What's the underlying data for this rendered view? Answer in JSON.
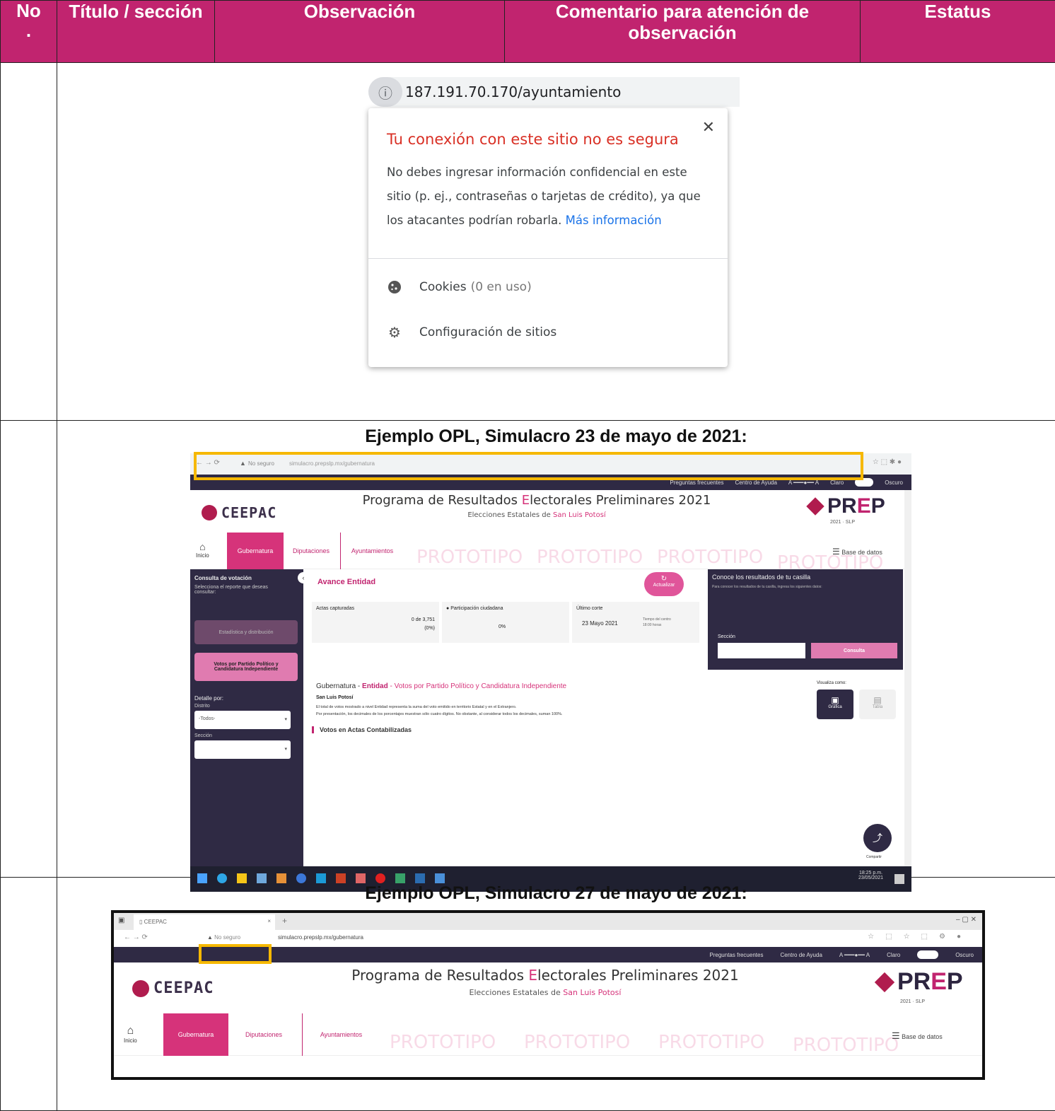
{
  "table": {
    "headers": {
      "no": "No\n.",
      "title": "Título / sección",
      "observation": "Observación",
      "comment": "Comentario para atención de observación",
      "status": "Estatus"
    }
  },
  "popup": {
    "url": "187.191.70.170/ayuntamiento",
    "title": "Tu conexión con este sitio no es segura",
    "body": "No debes ingresar información confidencial en este sitio (p. ej., contraseñas o tarjetas de crédito), ya que los atacantes podrían robarla.",
    "link": "Más información",
    "cookies_label": "Cookies",
    "cookies_count": "(0 en uso)",
    "settings_label": "Configuración de sitios"
  },
  "example1": {
    "caption": "Ejemplo OPL, Simulacro 23 de mayo de 2021:",
    "url_warning": "No seguro",
    "url": "simulacro.prepslp.mx/gubernatura",
    "top_links": [
      "Preguntas frecuentes",
      "Centro de Ayuda",
      "Claro",
      "Oscuro"
    ],
    "org": "CEEPAC",
    "header_title_pre": "Programa de Resultados ",
    "header_title_e": "E",
    "header_title_post": "lectorales Preliminares 2021",
    "header_sub_pre": "Elecciones Estatales de ",
    "header_sub_place": "San Luis Potosí",
    "prep_logo_pr": "PR",
    "prep_logo_e": "E",
    "prep_logo_p": "P",
    "prep_logo_sub": "2021 · SLP",
    "nav_home": "Inicio",
    "nav_tabs": [
      "Gubernatura",
      "Diputaciones",
      "Ayuntamientos"
    ],
    "watermark": "PROTOTIPO",
    "base_datos": "Base de datos",
    "sidebar": {
      "title": "Consulta de votación",
      "subtitle": "Selecciona el reporte que deseas consultar:",
      "btn1": "Estadística y distribución",
      "btn2": "Votos por Partido Político y Candidatura Independiente",
      "detail": "Detalle por:",
      "distrito": "Distrito",
      "select": "-Todos-",
      "seccion": "Sección"
    },
    "avance": {
      "title": "Avance Entidad",
      "refresh": "Actualizar",
      "actas_label": "Actas capturadas",
      "actas_value": "0 de 3,751",
      "actas_pct": "(0%)",
      "participacion_label": "Participación ciudadana",
      "participacion_value": "0%",
      "corte_label": "Último corte",
      "corte_date": "23 Mayo 2021",
      "corte_tz": "Tiempo del centro",
      "corte_time": "18:00 horas"
    },
    "consulta_box": {
      "title": "Conoce los resultados de tu casilla",
      "info": "Para conocer los resultados de tu casilla, ingresa los siguientes datos:",
      "seccion": "Sección",
      "button": "Consulta"
    },
    "main": {
      "heading_pre": "Gubernatura - ",
      "heading_entidad": "Entidad",
      "heading_post": " - Votos por Partido Político y Candidatura Independiente",
      "place": "San Luis Potosí",
      "note1": "El total de votos mostrado a nivel Entidad representa la suma del voto emitido en territorio Estatal y en el Extranjero.",
      "note2": "Por presentación, los decimales de los porcentajes muestran sólo cuatro dígitos. No obstante, al considerar todos los decimales, suman 100%.",
      "section": "Votos en Actas Contabilizadas",
      "visualiza": "Visualiza como:",
      "grafica": "Gráfica",
      "tabla": "Tabla",
      "compartir": "Compartir"
    },
    "taskbar_time": "18:25 p.m.",
    "taskbar_date": "23/05/2021"
  },
  "example2": {
    "caption": "Ejemplo OPL, Simulacro 27 de mayo de 2021:",
    "tab_title": "CEEPAC",
    "url_warning": "No seguro",
    "url": "simulacro.prepslp.mx/gubernatura",
    "top_links": [
      "Preguntas frecuentes",
      "Centro de Ayuda",
      "A",
      "A",
      "Claro",
      "Oscuro"
    ],
    "org": "CEEPAC",
    "header_title_pre": "Programa de Resultados ",
    "header_title_e": "E",
    "header_title_post": "lectorales Preliminares 2021",
    "header_sub_pre": "Elecciones Estatales de ",
    "header_sub_place": "San Luis Potosí",
    "prep_logo_pr": "PR",
    "prep_logo_e": "E",
    "prep_logo_p": "P",
    "prep_logo_sub": "2021 · SLP",
    "nav_home": "Inicio",
    "nav_tabs": [
      "Gubernatura",
      "Diputaciones",
      "Ayuntamientos"
    ],
    "watermark": "PROTOTIPO",
    "base_datos": "Base de datos"
  },
  "colors": {
    "header_bg": "#c1246f",
    "accent": "#d6337a",
    "dark": "#2f2a44",
    "highlight": "#f6b800",
    "danger": "#d93025",
    "link": "#1a73e8"
  }
}
